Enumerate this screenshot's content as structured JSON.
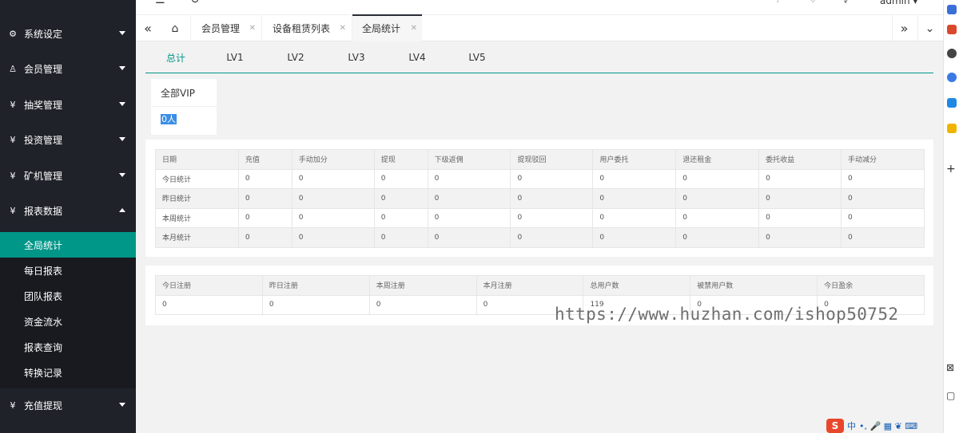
{
  "sidebar": {
    "items": [
      {
        "label": "系统设定",
        "icon": "gear-icon"
      },
      {
        "label": "会员管理",
        "icon": "user-icon"
      },
      {
        "label": "抽奖管理",
        "icon": "yen-icon"
      },
      {
        "label": "投资管理",
        "icon": "yen-icon"
      },
      {
        "label": "矿机管理",
        "icon": "yen-icon"
      },
      {
        "label": "报表数据",
        "icon": "yen-icon"
      },
      {
        "label": "充值提现",
        "icon": "yen-icon"
      }
    ],
    "submenu": [
      "全局统计",
      "每日报表",
      "团队报表",
      "资金流水",
      "报表查询",
      "转换记录"
    ],
    "icon_glyphs": {
      "gear": "⚙",
      "user": "♙",
      "yen": "¥"
    }
  },
  "header": {
    "menu_glyph": "☰",
    "refresh_glyph": "↻",
    "user": "admin ▾"
  },
  "tabs": {
    "prev_glyph": "«",
    "home_glyph": "⌂",
    "next_glyph": "»",
    "more_glyph": "⌄",
    "close_glyph": "✕",
    "items": [
      "会员管理",
      "设备租赁列表",
      "全局统计"
    ]
  },
  "level_tabs": [
    "总计",
    "LV1",
    "LV2",
    "LV3",
    "LV4",
    "LV5"
  ],
  "vip_card": {
    "title": "全部VIP",
    "value": "0人"
  },
  "stats_table": {
    "headers": [
      "日期",
      "充值",
      "手动加分",
      "提现",
      "下级返佣",
      "提现驳回",
      "用户委托",
      "退还租金",
      "委托收益",
      "手动减分"
    ],
    "rows": [
      [
        "今日统计",
        "0",
        "0",
        "0",
        "0",
        "0",
        "0",
        "0",
        "0",
        "0"
      ],
      [
        "昨日统计",
        "0",
        "0",
        "0",
        "0",
        "0",
        "0",
        "0",
        "0",
        "0"
      ],
      [
        "本周统计",
        "0",
        "0",
        "0",
        "0",
        "0",
        "0",
        "0",
        "0",
        "0"
      ],
      [
        "本月统计",
        "0",
        "0",
        "0",
        "0",
        "0",
        "0",
        "0",
        "0",
        "0"
      ]
    ]
  },
  "user_table": {
    "headers": [
      "今日注册",
      "昨日注册",
      "本周注册",
      "本月注册",
      "总用户数",
      "被禁用户数",
      "今日盈余"
    ],
    "row": [
      "0",
      "0",
      "0",
      "0",
      "119",
      "0",
      "0"
    ]
  },
  "watermark": "https://www.huzhan.com/ishop50752",
  "ime": {
    "logo": "S",
    "label": "中",
    "glyphs": "•, 🎤 ▦ ❦ ⌨"
  },
  "colors": {
    "accent": "#009688",
    "sidebar": "#20222a",
    "submenu": "#181a20"
  }
}
